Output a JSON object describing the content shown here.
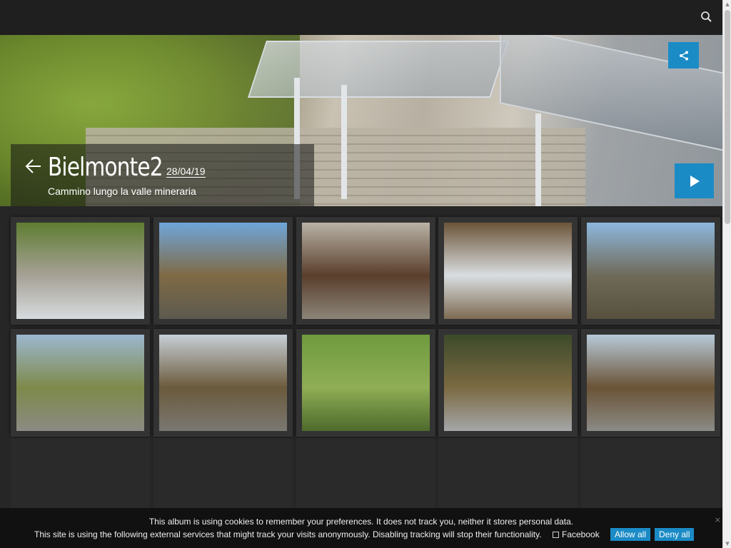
{
  "header": {
    "search_icon": "search-icon"
  },
  "hero": {
    "title": "Bielmonte2",
    "date": "28/04/19",
    "subtitle": "Cammino lungo la valle mineraria",
    "share_icon": "share-icon",
    "play_icon": "play-icon",
    "back_icon": "arrow-left-icon"
  },
  "gallery": {
    "thumbnails": [
      {
        "scene": "ruins with shelter roof",
        "colors": [
          "#5f7d32",
          "#a6a196",
          "#d7dbde"
        ]
      },
      {
        "scene": "mountain road, snowy peaks",
        "colors": [
          "#6fa6d9",
          "#7f6a45",
          "#5c5a4f"
        ]
      },
      {
        "scene": "stone furnace under roof",
        "colors": [
          "#b9b3a6",
          "#5a3e2c",
          "#8c8578"
        ]
      },
      {
        "scene": "waterfall in autumn woods",
        "colors": [
          "#6b5438",
          "#d9dde0",
          "#7d6b52"
        ]
      },
      {
        "scene": "road past rock cliff",
        "colors": [
          "#8db7de",
          "#6f6a58",
          "#57503e"
        ]
      },
      {
        "scene": "rocky stream valley",
        "colors": [
          "#9db7cf",
          "#7d8a4a",
          "#8c8a84"
        ]
      },
      {
        "scene": "gravel road through trees",
        "colors": [
          "#c7cfd6",
          "#6b5a3c",
          "#7a7872"
        ]
      },
      {
        "scene": "green hillside with farm",
        "colors": [
          "#6f9a3d",
          "#8fae55",
          "#4e6a2c"
        ]
      },
      {
        "scene": "small waterfall on rocks",
        "colors": [
          "#3c4a2a",
          "#7b6a42",
          "#a4a6a8"
        ]
      },
      {
        "scene": "roadside with fence",
        "colors": [
          "#b7c9d8",
          "#6a5336",
          "#8b8b86"
        ]
      }
    ]
  },
  "cookie": {
    "line1": "This album is using cookies to remember your preferences. It does not track you, neither it stores personal data.",
    "line2": "This site is using the following external services that might track your visits anonymously. Disabling tracking will stop their functionality.",
    "facebook": "Facebook",
    "allow_all": "Allow all",
    "deny_all": "Deny all",
    "close": "×"
  },
  "colors": {
    "accent": "#1b8bc6",
    "background": "#262626",
    "topbar": "#1f1f1f"
  }
}
